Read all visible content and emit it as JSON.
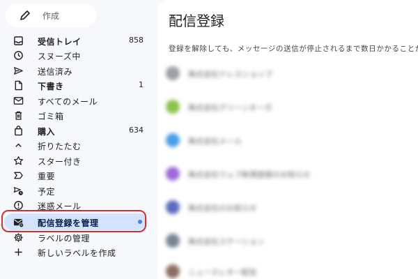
{
  "compose": {
    "label": "作成",
    "icon": "pencil-icon"
  },
  "nav": [
    {
      "id": "inbox",
      "label": "受信トレイ",
      "count": "858",
      "icon": "inbox-icon",
      "bold": true
    },
    {
      "id": "snoozed",
      "label": "スヌーズ中",
      "count": "",
      "icon": "clock-icon",
      "bold": false
    },
    {
      "id": "sent",
      "label": "送信済み",
      "count": "",
      "icon": "send-icon",
      "bold": false
    },
    {
      "id": "drafts",
      "label": "下書き",
      "count": "1",
      "icon": "draft-icon",
      "bold": true
    },
    {
      "id": "all-mail",
      "label": "すべてのメール",
      "count": "",
      "icon": "all-mail-icon",
      "bold": false
    },
    {
      "id": "trash",
      "label": "ゴミ箱",
      "count": "",
      "icon": "trash-icon",
      "bold": false
    },
    {
      "id": "purchases",
      "label": "購入",
      "count": "634",
      "icon": "shopping-bag-icon",
      "bold": true
    },
    {
      "id": "collapse",
      "label": "折りたたむ",
      "count": "",
      "icon": "chevron-up-icon",
      "bold": false
    },
    {
      "id": "starred",
      "label": "スター付き",
      "count": "",
      "icon": "star-icon",
      "bold": false
    },
    {
      "id": "important",
      "label": "重要",
      "count": "",
      "icon": "important-icon",
      "bold": false
    },
    {
      "id": "scheduled",
      "label": "予定",
      "count": "",
      "icon": "scheduled-icon",
      "bold": false
    },
    {
      "id": "spam",
      "label": "迷惑メール",
      "count": "",
      "icon": "spam-icon",
      "bold": false
    },
    {
      "id": "manage-subscriptions",
      "label": "配信登録を管理",
      "count": "",
      "icon": "manage-subscriptions-icon",
      "bold": true,
      "active": true
    },
    {
      "id": "manage-labels",
      "label": "ラベルの管理",
      "count": "",
      "icon": "gear-icon",
      "bold": false
    },
    {
      "id": "create-label",
      "label": "新しいラベルを作成",
      "count": "",
      "icon": "plus-icon",
      "bold": false
    }
  ],
  "main": {
    "title": "配信登録",
    "description": "登録を解除しても、メッセージの送信が停止されるまで数日かかることがあ"
  },
  "subscriptions": [
    {
      "name": "株式会社ドレスショップ",
      "color": "#9aa0a6"
    },
    {
      "name": "株式会社グリーンオーガ",
      "color": "#8bc34a"
    },
    {
      "name": "株式会社メール",
      "color": "#4a9fe8"
    },
    {
      "name": "株式会社ウェブ新規登録のお知らせ",
      "color": "#9c6ad8"
    },
    {
      "name": "株式会社のお知らせ",
      "color": "#5c6bc0"
    },
    {
      "name": "株式会社ステーション",
      "color": "#7a8594"
    },
    {
      "name": "ニュースレター配信",
      "color": "#8d6e63"
    }
  ],
  "colors": {
    "accent": "#d3e3fd",
    "highlight": "#d32f2f",
    "dot": "#4c7be0"
  }
}
